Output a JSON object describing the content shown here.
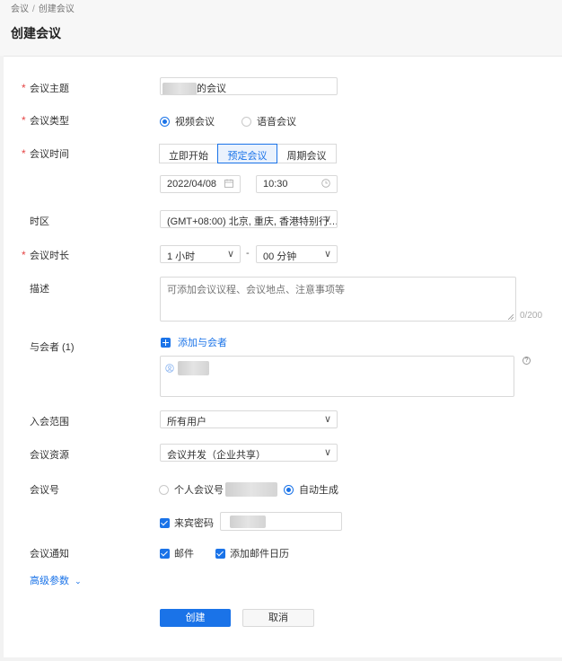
{
  "breadcrumb": {
    "items": [
      "会议",
      "创建会议"
    ],
    "separator": "/"
  },
  "page_title": "创建会议",
  "form": {
    "subject": {
      "label": "会议主题",
      "value_suffix": "的会议"
    },
    "type": {
      "label": "会议类型",
      "options": [
        "视频会议",
        "语音会议"
      ],
      "selected": "视频会议"
    },
    "time": {
      "label": "会议时间",
      "modes": [
        "立即开始",
        "预定会议",
        "周期会议"
      ],
      "active_mode": "预定会议",
      "date": "2022/04/08",
      "clock": "10:30"
    },
    "timezone": {
      "label": "时区",
      "value": "(GMT+08:00) 北京, 重庆, 香港特别行…"
    },
    "duration": {
      "label": "会议时长",
      "hours": "1 小时",
      "dash": "-",
      "minutes": "00 分钟"
    },
    "description": {
      "label": "描述",
      "placeholder": "可添加会议议程、会议地点、注意事项等",
      "counter": "0/200"
    },
    "participants": {
      "label": "与会者 (1)",
      "add_label": "添加与会者",
      "help": "?"
    },
    "scope": {
      "label": "入会范围",
      "value": "所有用户"
    },
    "resource": {
      "label": "会议资源",
      "value": "会议并发（企业共享）"
    },
    "meeting_id": {
      "label": "会议号",
      "options": [
        "个人会议号",
        "自动生成"
      ],
      "selected": "自动生成"
    },
    "guest_password": {
      "label": "来宾密码",
      "checked": true
    },
    "notify": {
      "label": "会议通知",
      "options": [
        "邮件",
        "添加邮件日历"
      ]
    },
    "advanced": {
      "label": "高级参数",
      "caret": "⌄"
    }
  },
  "buttons": {
    "create": "创建",
    "cancel": "取消"
  },
  "colors": {
    "accent": "#1a73e8",
    "required": "#e54545"
  },
  "icons": {
    "required_marker": "*",
    "dropdown": "∨"
  }
}
